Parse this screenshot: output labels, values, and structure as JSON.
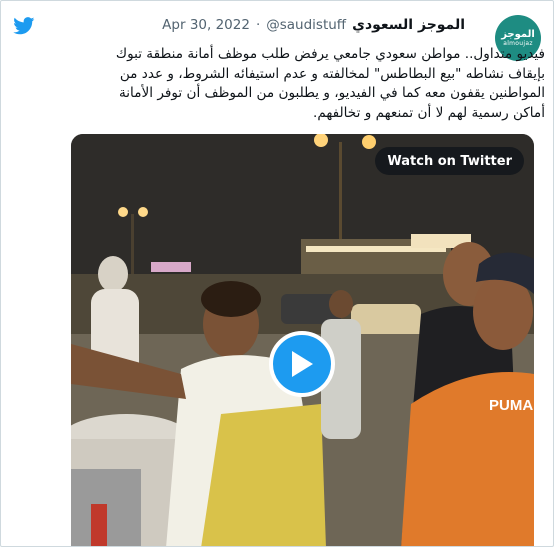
{
  "tweet": {
    "display_name": "الموجز السعودي",
    "handle": "@saudistuff",
    "separator": "·",
    "date": "Apr 30, 2022",
    "avatar": {
      "text_ar": "الموجز",
      "text_en": "almoujaz"
    },
    "text_lines": [
      "فيديو متداول.. مواطن سعودي جامعي يرفض طلب موظف أمانة منطقة تبوك",
      "بإيقاف نشاطه \"بيع البطاطس\" لمخالفته و عدم استيفائه الشروط، و عدد من",
      "المواطنين يقفون معه كما في الفيديو، و يطلبون من الموظف أن توفر الأمانة",
      "أماكن رسمية لهم لا أن تمنعهم و تخالفهم."
    ]
  },
  "media": {
    "watch_label": "Watch on Twitter",
    "play_icon": "play-icon",
    "shirt_text": "PUMA"
  },
  "colors": {
    "twitter_blue": "#1d9bf0",
    "avatar_bg": "#1e8c82",
    "secondary_text": "#536471"
  }
}
